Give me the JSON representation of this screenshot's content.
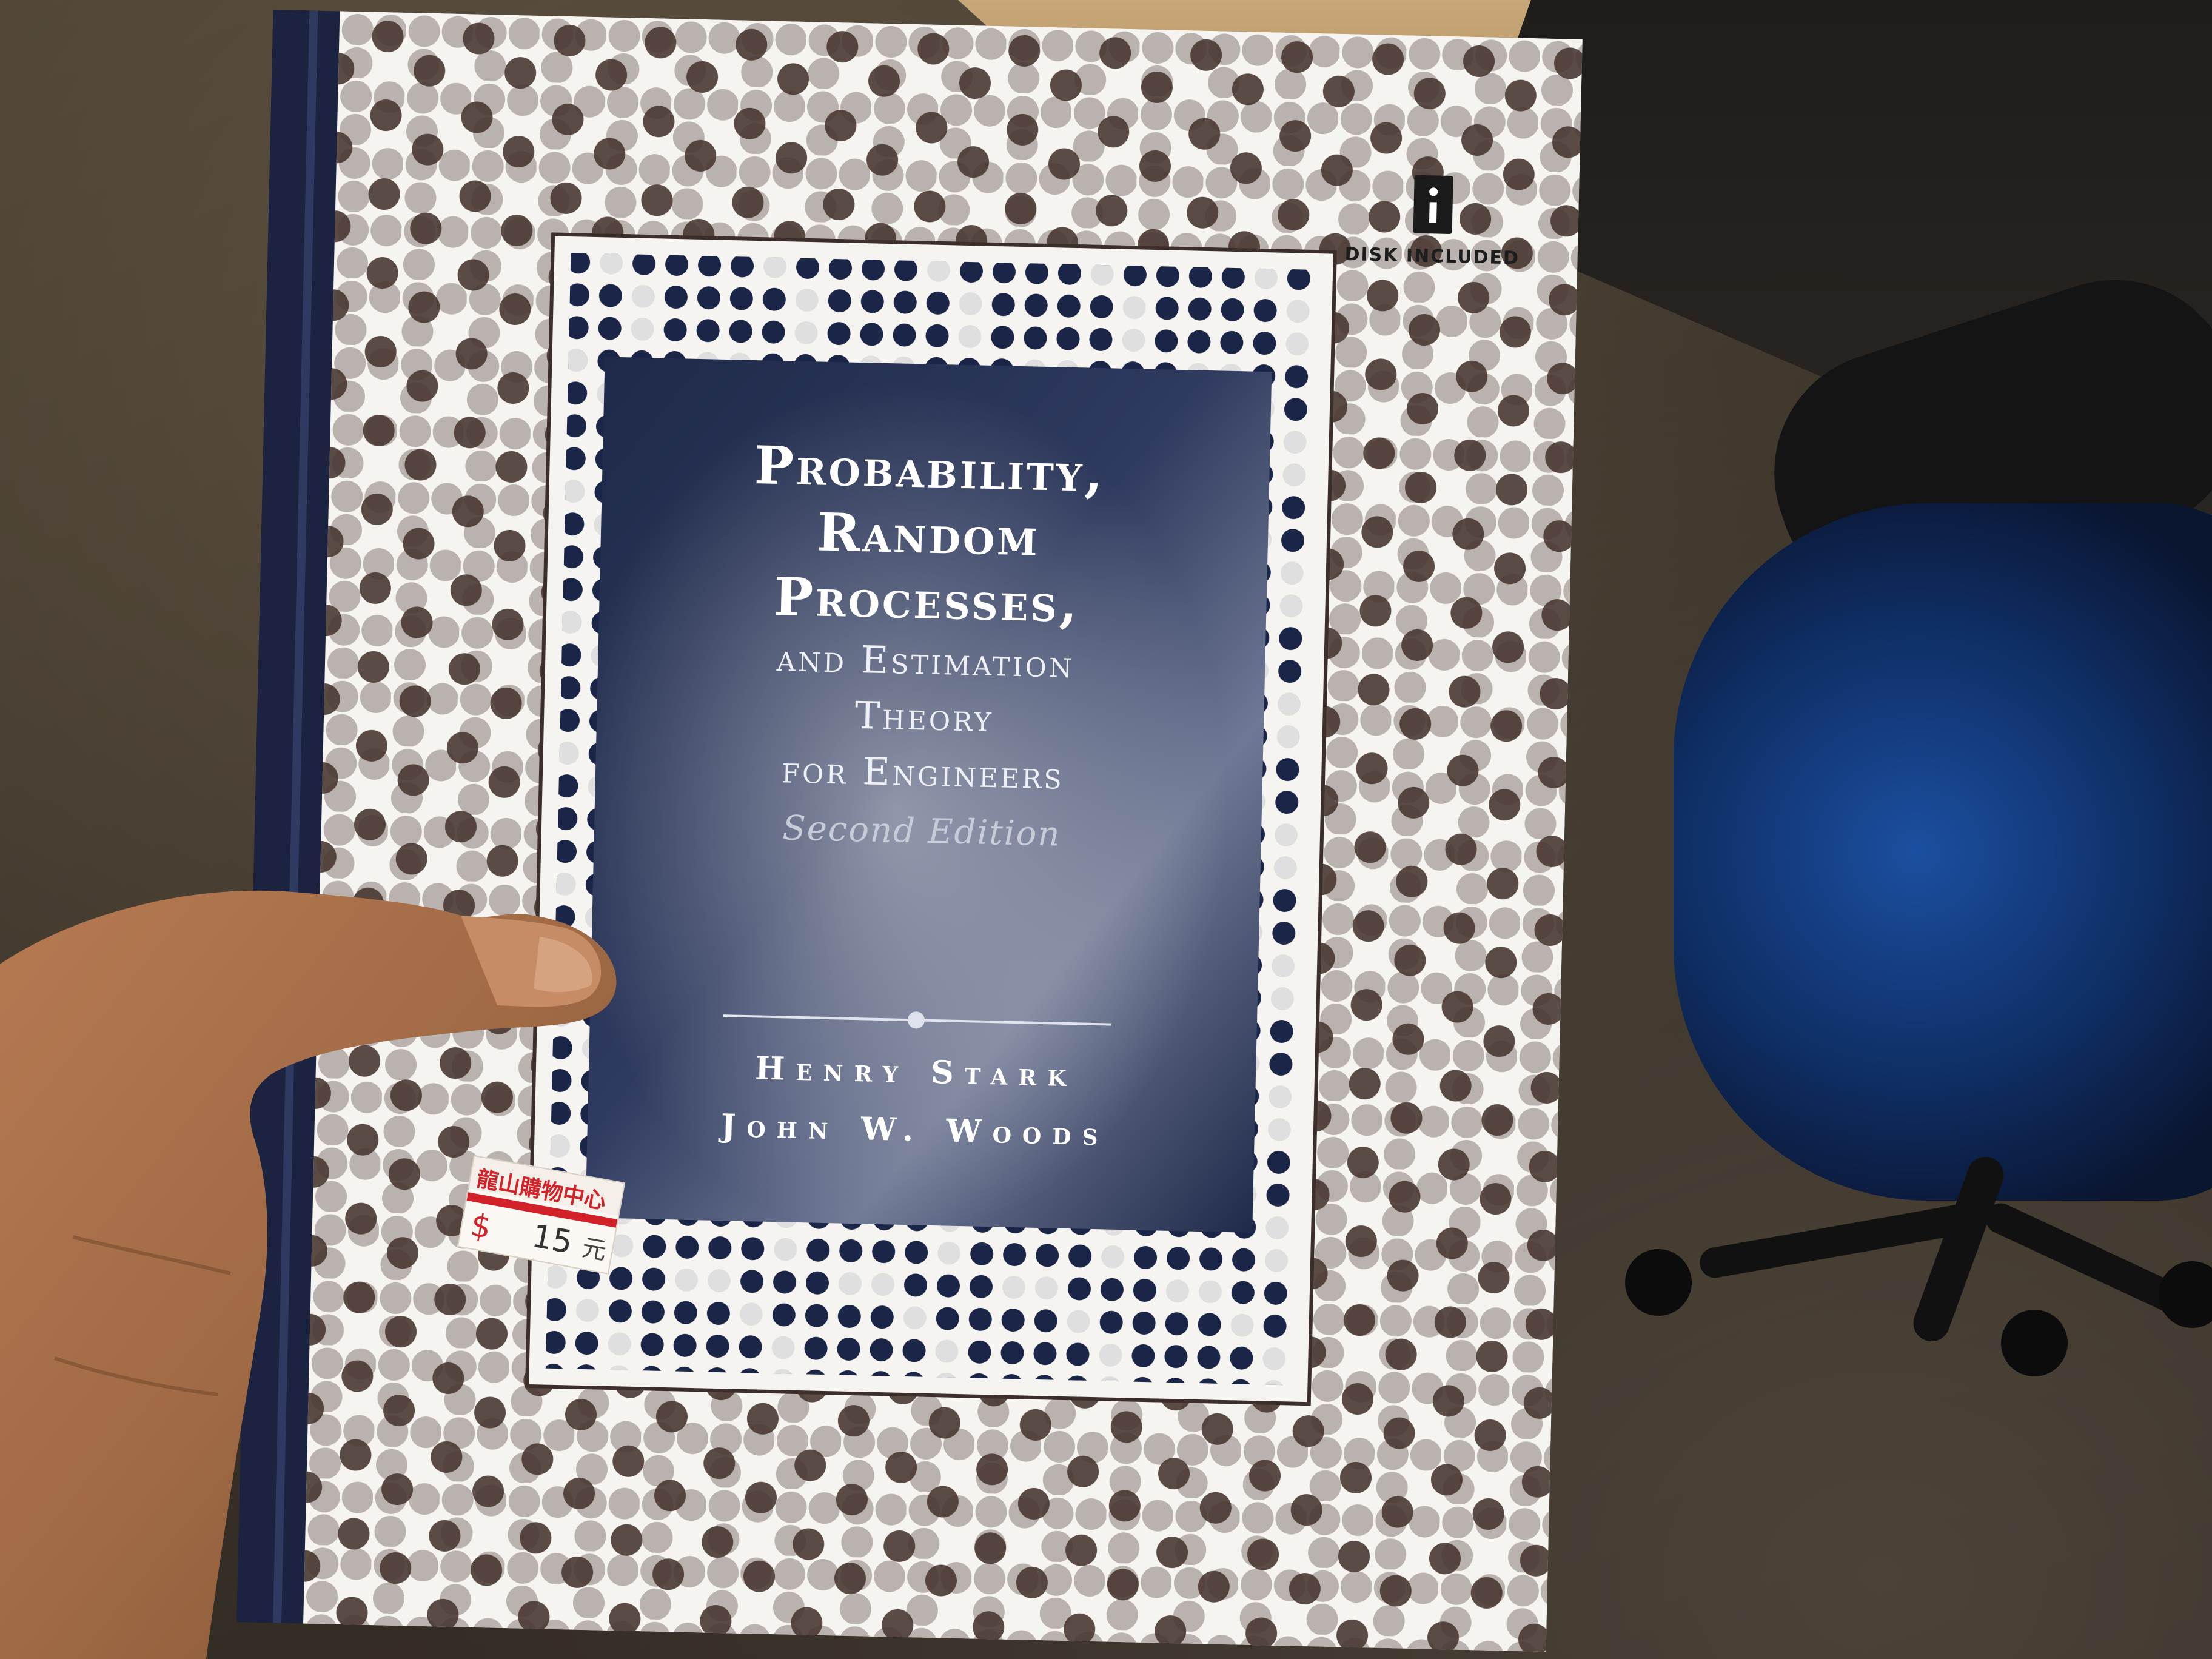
{
  "cover": {
    "title_lines": [
      "Probability,",
      "Random",
      "Processes,"
    ],
    "subtitle_lines": [
      "and Estimation",
      "Theory",
      "for Engineers"
    ],
    "edition": "Second Edition",
    "authors": [
      "Henry Stark",
      "John W. Woods"
    ],
    "badge_label": "DISK INCLUDED",
    "badge_icon": "disk-info-icon"
  },
  "price_sticker": {
    "store_name": "龍山購物中心",
    "currency_symbol": "$",
    "amount": "15",
    "unit": "元"
  },
  "colors": {
    "cover_white": "#f6f4f1",
    "dot_brown": "#4a3832",
    "panel_navy": "#263050",
    "dot_navy": "#1a2548",
    "spine_navy": "#1b2340",
    "sticker_red": "#d3212a",
    "chair_blue": "#1b4fa0"
  }
}
